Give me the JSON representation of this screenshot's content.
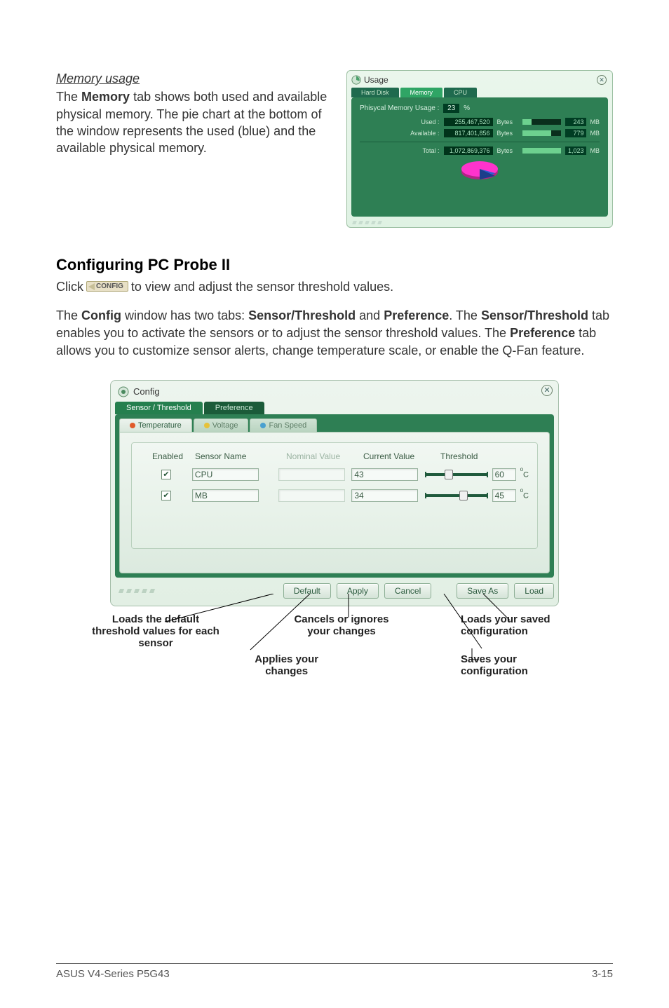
{
  "memory_section": {
    "heading": "Memory usage",
    "para_before_bold": "The ",
    "bold1": "Memory",
    "para_after": " tab shows both used and available physical memory. The pie chart at the bottom of the window represents the used (blue) and the available physical memory."
  },
  "usage_panel": {
    "title": "Usage",
    "tabs": {
      "hard": "Hard Disk",
      "memory": "Memory",
      "cpu": "CPU"
    },
    "phy_label_a": "Phisycal Memory Usage :",
    "phy_pct": "23",
    "phy_label_b": "%",
    "rows": [
      {
        "label": "Used :",
        "bytes": "255,467,520",
        "unit1": "Bytes",
        "fill": 24,
        "mb": "243",
        "unit2": "MB"
      },
      {
        "label": "Available :",
        "bytes": "817,401,856",
        "unit1": "Bytes",
        "fill": 76,
        "mb": "779",
        "unit2": "MB"
      },
      {
        "label": "Total :",
        "bytes": "1,072,869,376",
        "unit1": "Bytes",
        "fill": 100,
        "mb": "1,023",
        "unit2": "MB"
      }
    ]
  },
  "configuring": {
    "heading": "Configuring PC Probe II",
    "click_a": "Click ",
    "config_btn": "CONFIG",
    "click_b": " to view and adjust the sensor threshold values.",
    "para": {
      "a": "The ",
      "b": "Config",
      "c": " window has two tabs: ",
      "d": "Sensor/Threshold",
      "e": " and ",
      "f": "Preference",
      "g": ". The ",
      "h": "Sensor/Threshold",
      "i": " tab enables you to activate the sensors or to adjust the sensor threshold values. The ",
      "j": "Preference",
      "k": " tab allows you to customize sensor alerts, change temperature scale, or enable the Q-Fan feature."
    }
  },
  "config_window": {
    "title": "Config",
    "tabs1": {
      "sensor": "Sensor / Threshold",
      "pref": "Preference"
    },
    "tabs2": {
      "temp": "Temperature",
      "volt": "Voltage",
      "fan": "Fan Speed"
    },
    "headers": {
      "enabled": "Enabled",
      "sensor": "Sensor Name",
      "nominal": "Nominal Value",
      "current": "Current Value",
      "threshold": "Threshold"
    },
    "rows": [
      {
        "name": "CPU",
        "current": "43",
        "threshold": "60",
        "thumb": 32
      },
      {
        "name": "MB",
        "current": "34",
        "threshold": "45",
        "thumb": 55
      }
    ],
    "unit": "C",
    "buttons": {
      "default": "Default",
      "apply": "Apply",
      "cancel": "Cancel",
      "saveas": "Save As",
      "load": "Load"
    }
  },
  "annotations": {
    "default": "Loads the default threshold values for each sensor",
    "apply": "Applies your changes",
    "cancel": "Cancels or ignores your changes",
    "load": "Loads your saved configuration",
    "saveas": "Saves your configuration"
  },
  "footer": {
    "left": "ASUS V4-Series P5G43",
    "right": "3-15"
  }
}
